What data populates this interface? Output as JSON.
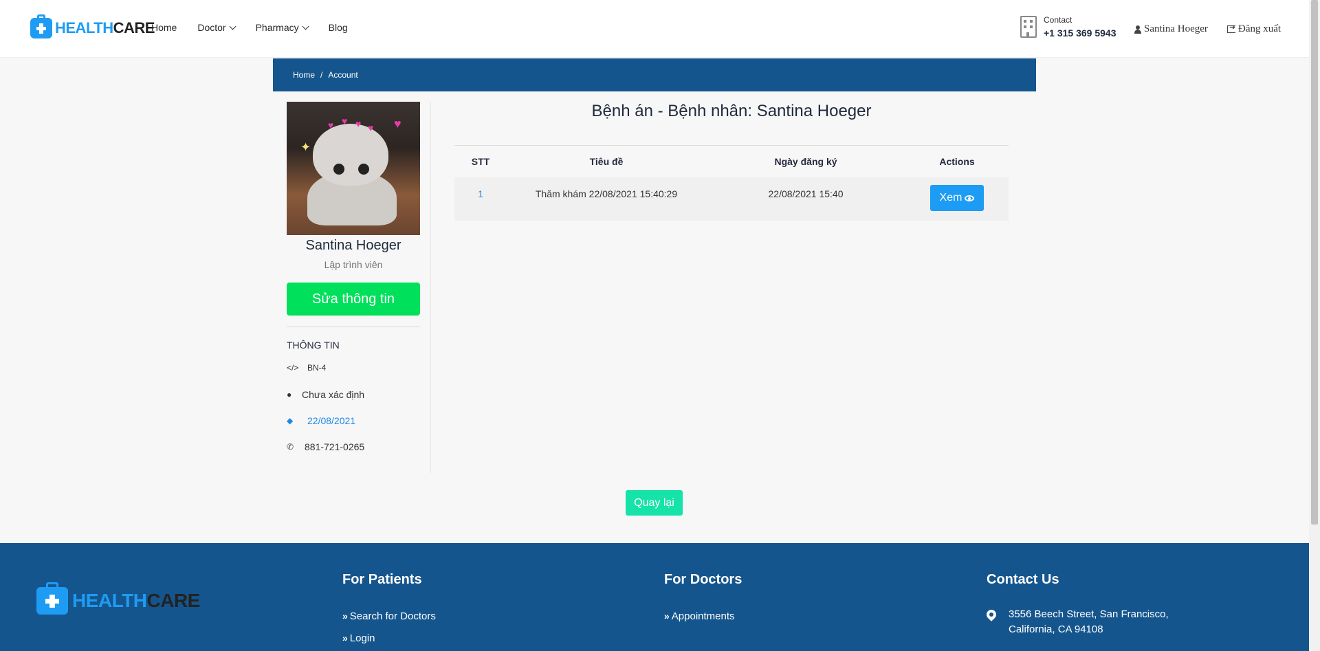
{
  "header": {
    "logo_part1": "HEALTH",
    "logo_part2": "CARE",
    "nav": {
      "home": "Home",
      "doctor": "Doctor",
      "pharmacy": "Pharmacy",
      "blog": "Blog"
    },
    "contact_label": "Contact",
    "contact_phone": "+1 315 369 5943",
    "user_name": "Santina Hoeger",
    "logout": "Đăng xuất"
  },
  "breadcrumb": {
    "home": "Home",
    "separator": "/",
    "current": "Account"
  },
  "profile": {
    "name": "Santina Hoeger",
    "role": "Lập trình viên",
    "edit_button": "Sửa thông tin",
    "info_title": "THÔNG TIN",
    "code": "BN-4",
    "location": "Chưa xác định",
    "date": "22/08/2021",
    "phone": "881-721-0265"
  },
  "main": {
    "title": "Bệnh án - Bệnh nhân: Santina Hoeger",
    "table": {
      "headers": [
        "STT",
        "Tiêu đề",
        "Ngày đăng ký",
        "Actions"
      ],
      "rows": [
        {
          "stt": "1",
          "title": "Thăm khám 22/08/2021 15:40:29",
          "date": "22/08/2021 15:40",
          "action": "Xem"
        }
      ]
    },
    "back_button": "Quay lại"
  },
  "footer": {
    "logo_part1": "HEALTH",
    "logo_part2": "CARE",
    "patients_title": "For Patients",
    "patients_links": [
      "Search for Doctors",
      "Login"
    ],
    "doctors_title": "For Doctors",
    "doctors_links": [
      "Appointments"
    ],
    "contact_title": "Contact Us",
    "address_line1": "3556 Beech Street, San Francisco,",
    "address_line2": "California, CA 94108"
  },
  "colors": {
    "brand_blue": "#15558d",
    "accent_blue": "#1e9cf4",
    "edit_green": "#00e05a",
    "back_teal": "#15e3a8"
  }
}
